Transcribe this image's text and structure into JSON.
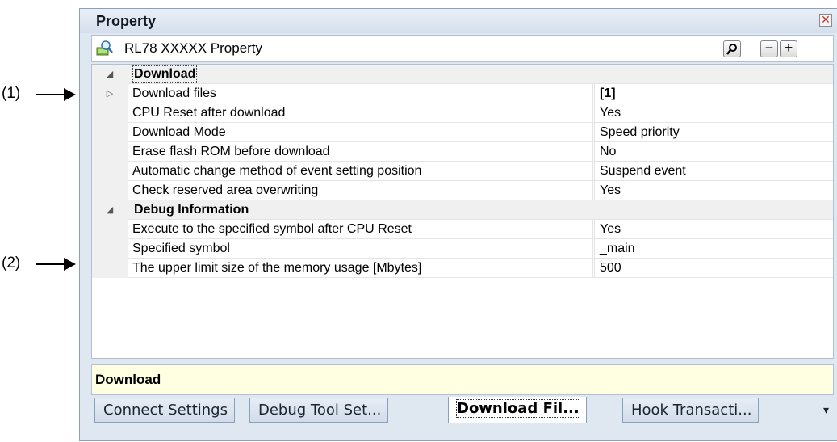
{
  "callouts": [
    "(1)",
    "(2)"
  ],
  "panel": {
    "title": "Property",
    "subtitle": "RL78 XXXXX Property",
    "toolbar": {
      "search_icon": "magnifier-icon",
      "collapse_label": "−",
      "expand_label": "+"
    }
  },
  "grid": {
    "categories": [
      {
        "label": "Download",
        "expander": "◢",
        "rows": [
          {
            "name": "Download files",
            "value": "[1]",
            "expander": "▷"
          },
          {
            "name": "CPU Reset after download",
            "value": "Yes"
          },
          {
            "name": "Download Mode",
            "value": "Speed priority"
          },
          {
            "name": "Erase flash ROM before download",
            "value": "No"
          },
          {
            "name": "Automatic change method of event setting position",
            "value": "Suspend event"
          },
          {
            "name": "Check reserved area overwriting",
            "value": "Yes"
          }
        ]
      },
      {
        "label": "Debug Information",
        "expander": "◢",
        "rows": [
          {
            "name": "Execute to the specified symbol after CPU Reset",
            "value": "Yes"
          },
          {
            "name": "Specified symbol",
            "value": "_main"
          },
          {
            "name": "The upper limit size of the memory usage [Mbytes]",
            "value": "500"
          }
        ]
      }
    ]
  },
  "description": "Download",
  "tabs": [
    "Connect Settings",
    "Debug Tool Set...",
    "Download Fil...",
    "Hook Transacti..."
  ],
  "active_tab": "Download Fil...",
  "tab_menu": "▾",
  "colors": {
    "accent": "#dfe7f1",
    "description_bg": "#ffffe1"
  }
}
